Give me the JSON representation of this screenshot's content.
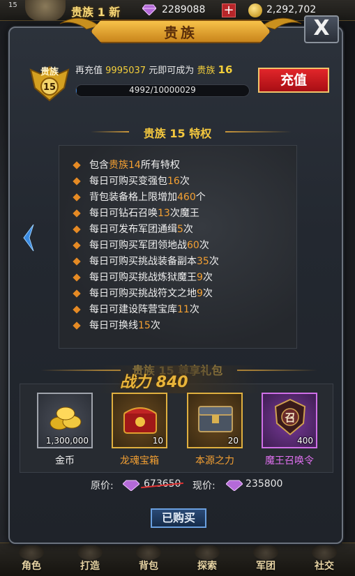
{
  "topbar": {
    "level": "15",
    "vip_label": "贵族 1 新",
    "gems": "2289088",
    "plus": "+",
    "coins": "2,292,702"
  },
  "dialog": {
    "title": "贵族",
    "close": "X",
    "badge": {
      "label": "贵族",
      "level": "15"
    },
    "recharge": {
      "prefix": "再充值",
      "amount": "9995037",
      "middle": "元即可成为",
      "noble": "贵族",
      "target_level": "16"
    },
    "progress": {
      "text": "4992/10000029",
      "fraction": 0.0005
    },
    "recharge_button": "充值",
    "privilege_heading": "贵族 15 特权",
    "privileges": [
      {
        "pre": "包含",
        "hl": "贵族14",
        "post": "所有特权"
      },
      {
        "pre": "每日可购买变强包",
        "hl": "16",
        "post": "次"
      },
      {
        "pre": "背包装备格上限增加",
        "hl": "460",
        "post": "个"
      },
      {
        "pre": "每日可钻石召唤",
        "hl": "13",
        "post": "次魔王"
      },
      {
        "pre": "每日可发布军团通缉",
        "hl": "5",
        "post": "次"
      },
      {
        "pre": "每日可购买军团领地战",
        "hl": "60",
        "post": "次"
      },
      {
        "pre": "每日可购买挑战装备副本",
        "hl": "35",
        "post": "次"
      },
      {
        "pre": "每日可购买挑战炼狱魔王",
        "hl": "9",
        "post": "次"
      },
      {
        "pre": "每日可购买挑战符文之地",
        "hl": "9",
        "post": "次"
      },
      {
        "pre": "每日可建设阵营宝库",
        "hl": "11",
        "post": "次"
      },
      {
        "pre": "每日可换线",
        "hl": "15",
        "post": "次"
      }
    ],
    "gift_heading": "贵族 15 尊享礼包",
    "power": "战力 840",
    "items": [
      {
        "name": "金币",
        "count": "1,300,000",
        "icon": "gold-coins-icon",
        "name_color": "#f0f0f0"
      },
      {
        "name": "龙魂宝箱",
        "count": "10",
        "icon": "red-chest-icon",
        "name_color": "#f4a032"
      },
      {
        "name": "本源之力",
        "count": "20",
        "icon": "silver-chest-icon",
        "name_color": "#f4a032"
      },
      {
        "name": "魔王召唤令",
        "count": "400",
        "icon": "summon-token-icon",
        "name_color": "#e070f0"
      }
    ],
    "price": {
      "original_label": "原价:",
      "original_value": "673650",
      "current_label": "现价:",
      "current_value": "235800"
    },
    "bought_button": "已购买"
  },
  "bottom_nav": [
    "角色",
    "打造",
    "背包",
    "探索",
    "军团",
    "社交"
  ]
}
